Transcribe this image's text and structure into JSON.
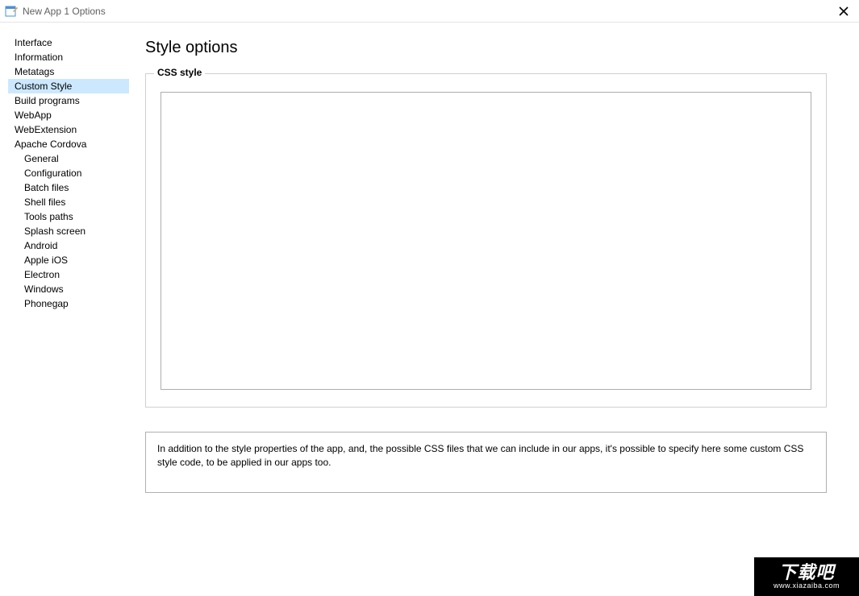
{
  "window": {
    "title": "New App 1 Options"
  },
  "sidebar": {
    "items": [
      {
        "label": "Interface",
        "selected": false,
        "sub": false
      },
      {
        "label": "Information",
        "selected": false,
        "sub": false
      },
      {
        "label": "Metatags",
        "selected": false,
        "sub": false
      },
      {
        "label": "Custom Style",
        "selected": true,
        "sub": false
      },
      {
        "label": "Build programs",
        "selected": false,
        "sub": false
      },
      {
        "label": "WebApp",
        "selected": false,
        "sub": false
      },
      {
        "label": "WebExtension",
        "selected": false,
        "sub": false
      },
      {
        "label": "Apache Cordova",
        "selected": false,
        "sub": false
      },
      {
        "label": "General",
        "selected": false,
        "sub": true
      },
      {
        "label": "Configuration",
        "selected": false,
        "sub": true
      },
      {
        "label": "Batch files",
        "selected": false,
        "sub": true
      },
      {
        "label": "Shell files",
        "selected": false,
        "sub": true
      },
      {
        "label": "Tools paths",
        "selected": false,
        "sub": true
      },
      {
        "label": "Splash screen",
        "selected": false,
        "sub": true
      },
      {
        "label": "Android",
        "selected": false,
        "sub": true
      },
      {
        "label": "Apple iOS",
        "selected": false,
        "sub": true
      },
      {
        "label": "Electron",
        "selected": false,
        "sub": true
      },
      {
        "label": "Windows",
        "selected": false,
        "sub": true
      },
      {
        "label": "Phonegap",
        "selected": false,
        "sub": true
      }
    ]
  },
  "main": {
    "title": "Style options",
    "fieldset_label": "CSS style",
    "textarea_value": "",
    "help_text": "In addition to the style properties of the app, and, the possible CSS files that we can include in our apps, it's possible to specify here some custom CSS style code, to be applied in our apps too."
  },
  "watermark": {
    "big": "下载吧",
    "url": "www.xiazaiba.com"
  }
}
